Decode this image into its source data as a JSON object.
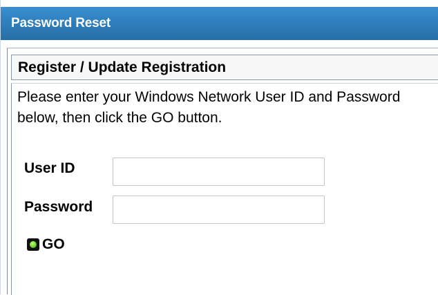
{
  "app": {
    "panel_title": "Password Reset"
  },
  "section": {
    "title": "Register / Update Registration"
  },
  "form": {
    "instructions": "Please enter your Windows Network User ID and Password below, then click the GO button.",
    "user_id_label": "User ID",
    "user_id_value": "",
    "password_label": "Password",
    "password_value": "",
    "go_label": "GO"
  },
  "icons": {
    "go_button_icon": "green-dot-icon"
  },
  "colors": {
    "header_blue": "#2f7fbe",
    "header_text": "#ffffff",
    "go_icon_green": "#6ad52f"
  }
}
